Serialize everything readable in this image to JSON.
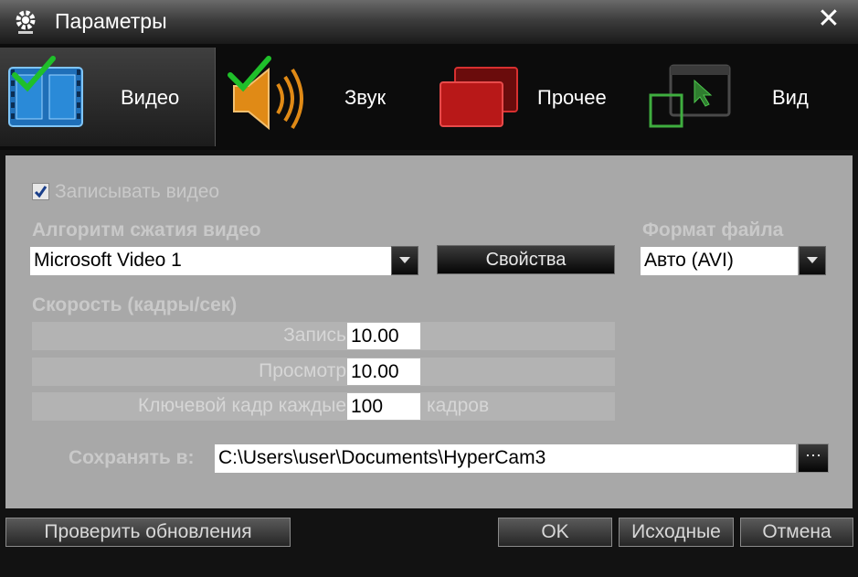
{
  "window": {
    "title": "Параметры",
    "close_glyph": "✕"
  },
  "tabs": [
    {
      "label": "Видео",
      "icon": "video-film-icon",
      "active": true
    },
    {
      "label": "Звук",
      "icon": "speaker-icon",
      "active": false
    },
    {
      "label": "Прочее",
      "icon": "other-windows-icon",
      "active": false
    },
    {
      "label": "Вид",
      "icon": "view-cursor-icon",
      "active": false
    }
  ],
  "video": {
    "record_label": "Записывать видео",
    "record_checked": true,
    "codec_label": "Алгоритм сжатия видео",
    "codec_value": "Microsoft Video 1",
    "properties_button": "Свойства",
    "format_label": "Формат файла",
    "format_value": "Авто (AVI)",
    "speed_label": "Скорость (кадры/сек)",
    "record_fps_label": "Запись",
    "record_fps_value": "10.00",
    "preview_fps_label": "Просмотр",
    "preview_fps_value": "10.00",
    "keyframe_label": "Ключевой кадр каждые",
    "keyframe_value": "100",
    "keyframe_unit": "кадров",
    "save_to_label": "Сохранять в:",
    "save_to_path": "C:\\Users\\user\\Documents\\HyperCam3",
    "browse_glyph": "···"
  },
  "footer": {
    "check_updates": "Проверить обновления",
    "ok": "OK",
    "defaults": "Исходные",
    "cancel": "Отмена"
  },
  "colors": {
    "check_green": "#1fbf2a",
    "panel_bg": "#a8a8a8",
    "video_icon_blue": "#2f8fd8",
    "sound_icon_orange": "#e08a16",
    "other_icon_red": "#cc2020",
    "view_icon_green": "#3fae3f"
  }
}
